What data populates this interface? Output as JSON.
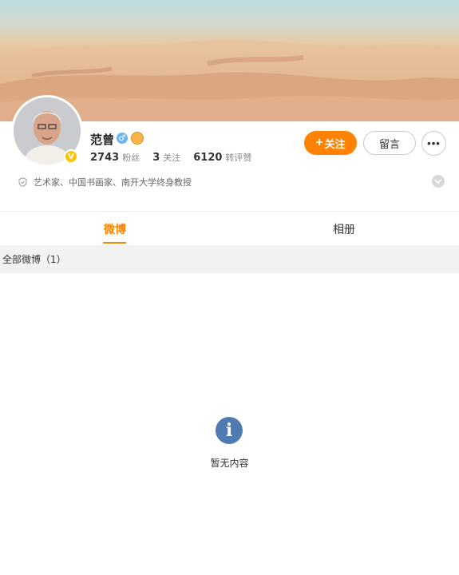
{
  "profile": {
    "name": "范曾",
    "gender_symbol": "♂",
    "verified_mark": "V",
    "stats": [
      {
        "value": "2743",
        "label": "粉丝"
      },
      {
        "value": "3",
        "label": "关注"
      },
      {
        "value": "6120",
        "label": "转评赞"
      }
    ],
    "description": "艺术家、中国书画家、南开大学终身教授"
  },
  "actions": {
    "follow_icon": "+",
    "follow_label": "关注",
    "message_label": "留言",
    "more_label": "•••"
  },
  "tabs": [
    {
      "label": "微博",
      "active": true
    },
    {
      "label": "相册",
      "active": false
    }
  ],
  "feed": {
    "header": "全部微博（1）",
    "empty_text": "暂无内容",
    "empty_icon_glyph": "i"
  },
  "colors": {
    "accent": "#ff8200",
    "info_icon": "#4f7bb1",
    "verified": "#ffc300"
  }
}
